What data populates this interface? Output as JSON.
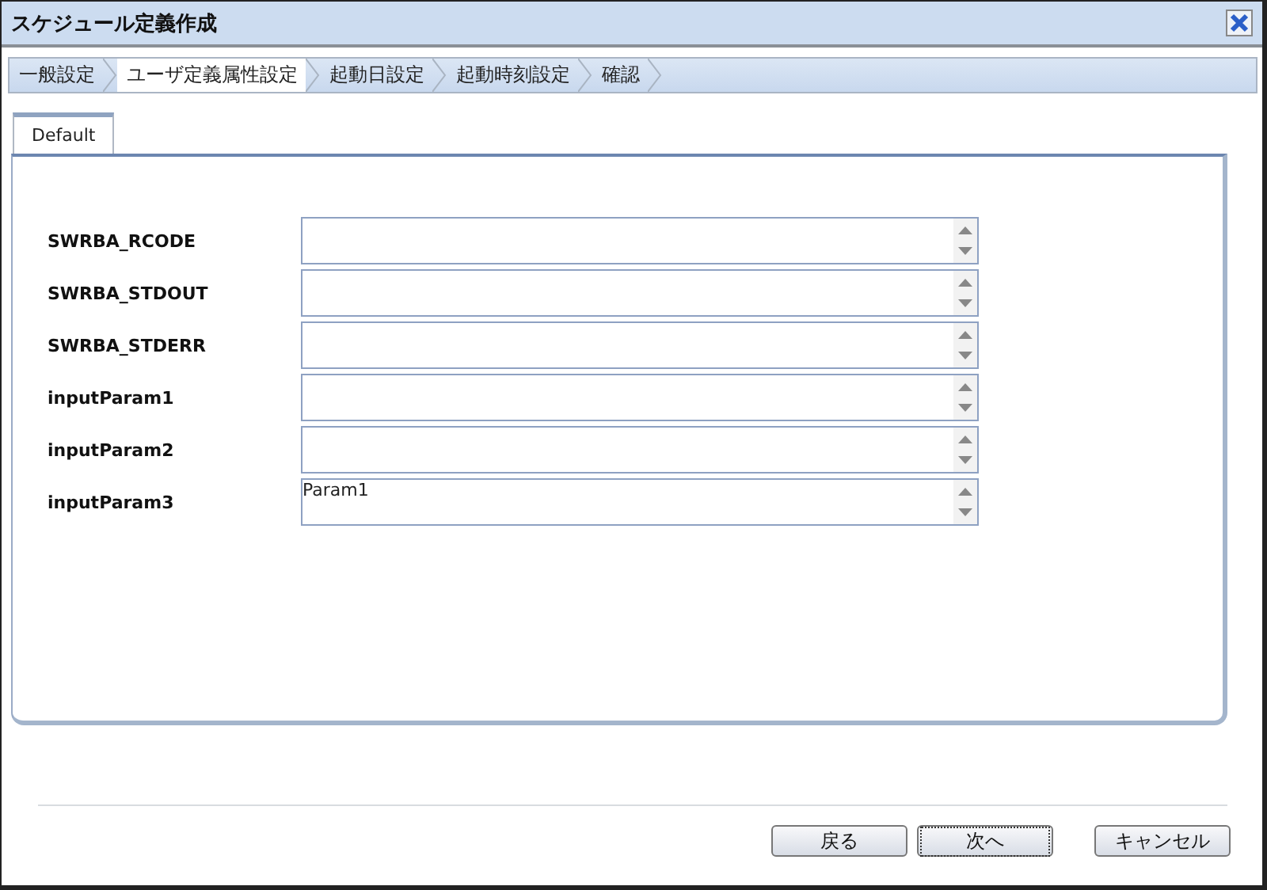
{
  "window": {
    "title": "スケジュール定義作成"
  },
  "steps": [
    {
      "label": "一般設定",
      "selected": false
    },
    {
      "label": "ユーザ定義属性設定",
      "selected": true
    },
    {
      "label": "起動日設定",
      "selected": false
    },
    {
      "label": "起動時刻設定",
      "selected": false
    },
    {
      "label": "確認",
      "selected": false
    }
  ],
  "tabs": [
    {
      "label": "Default",
      "selected": true
    }
  ],
  "fields": [
    {
      "label": "SWRBA_RCODE"
    },
    {
      "label": "SWRBA_STDOUT"
    },
    {
      "label": "SWRBA_STDERR"
    },
    {
      "label": "inputParam1"
    },
    {
      "label": "inputParam2"
    },
    {
      "label": "inputParam3",
      "value": "Param1"
    }
  ],
  "buttons": [
    {
      "label": "戻る",
      "focused": false
    },
    {
      "label": "次へ",
      "focused": true
    },
    {
      "label": "キャンセル",
      "focused": false
    }
  ]
}
